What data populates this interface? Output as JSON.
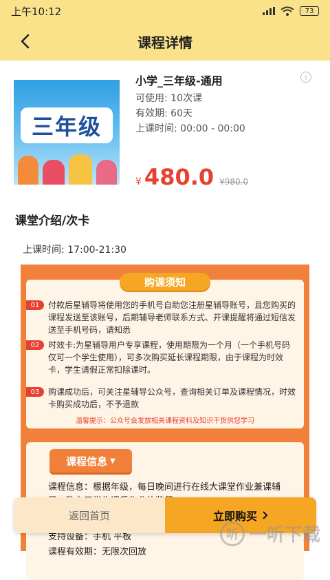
{
  "status": {
    "time": "上午10:12",
    "battery": "73"
  },
  "header": {
    "title": "课程详情"
  },
  "course": {
    "cover_text": "三年级",
    "name": "小学_三年级-通用",
    "usage": "可使用: 10次课",
    "validity": "有效期: 60天",
    "class_hours": "上课时间: 00:00 - 00:00",
    "currency": "¥",
    "price": "480.0",
    "original_price": "¥980.0"
  },
  "intro": {
    "title": "课堂介绍/次卡",
    "class_time": "上课时间:  17:00-21:30"
  },
  "notice": {
    "title": "购课须知",
    "items": [
      {
        "num": "01",
        "text": "付款后星辅导将使用您的手机号自助您注册星辅导账号，且您购买的课程发送至该账号，后期辅导老师联系方式、开课提醒将通过短信发送至手机号码，请知悉"
      },
      {
        "num": "02",
        "text": "时效卡:为星辅导用户专享课程，使用期限为一个月（一个手机号码仅可一个学生使用），可多次购买延长课程期限，由于课程为时效卡，学生请假正常扣除课时。"
      },
      {
        "num": "03",
        "text": "购课成功后，可关注星辅导公众号，查询相关订单及课程情况，时效卡购买成功后，不予退款"
      }
    ],
    "tip": "温馨提示：公众号会发放相关课程资料及知识干货供您学习"
  },
  "course_info": {
    "title": "课程信息",
    "lines": [
      "课程信息：根据年级，每日晚间进行在线大课堂作业兼课辅导：致力于学生课后作业的监督。",
      "支持设备：手机  平板",
      "课程有效期：无限次回放"
    ]
  },
  "bottom": {
    "home_label": "返回首页",
    "buy_label": "立即购买"
  },
  "watermark": {
    "text": "一听下载",
    "logo": "听"
  }
}
